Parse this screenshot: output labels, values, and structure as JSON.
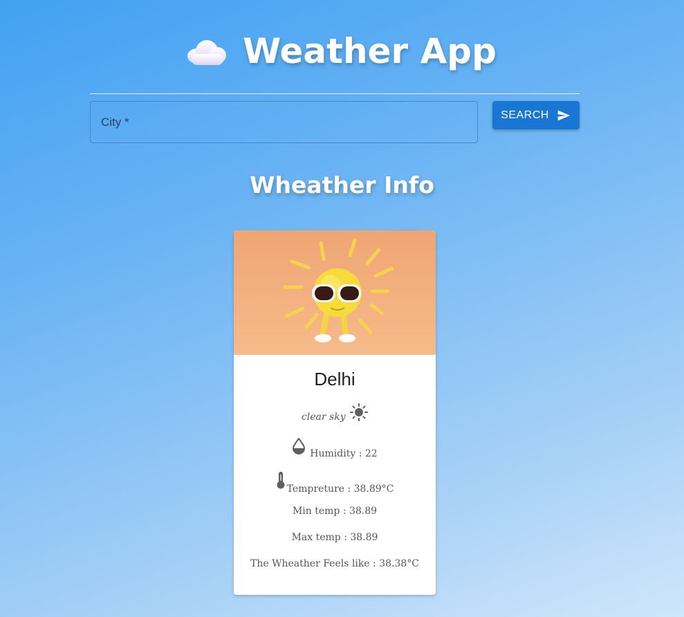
{
  "header": {
    "title": "Weather App",
    "icon": "cloud-icon"
  },
  "search": {
    "placeholder": "City *",
    "value": "",
    "button_label": "SEARCH",
    "button_icon": "send-icon",
    "button_color": "#1976d2"
  },
  "info": {
    "title": "Wheather Info"
  },
  "card": {
    "image": "sun-with-sunglasses-illustration",
    "city": "Delhi",
    "description": "clear sky",
    "description_icon": "sunny-icon",
    "humidity_label": "Humidity : 22",
    "humidity_icon": "water-drop-icon",
    "temperature_label": "Tempreture : 38.89°C",
    "temperature_icon": "thermometer-icon",
    "min_temp_label": "Min temp : 38.89",
    "max_temp_label": "Max temp : 38.89",
    "feels_like_label": "The Wheather Feels like : 38.38°C"
  }
}
